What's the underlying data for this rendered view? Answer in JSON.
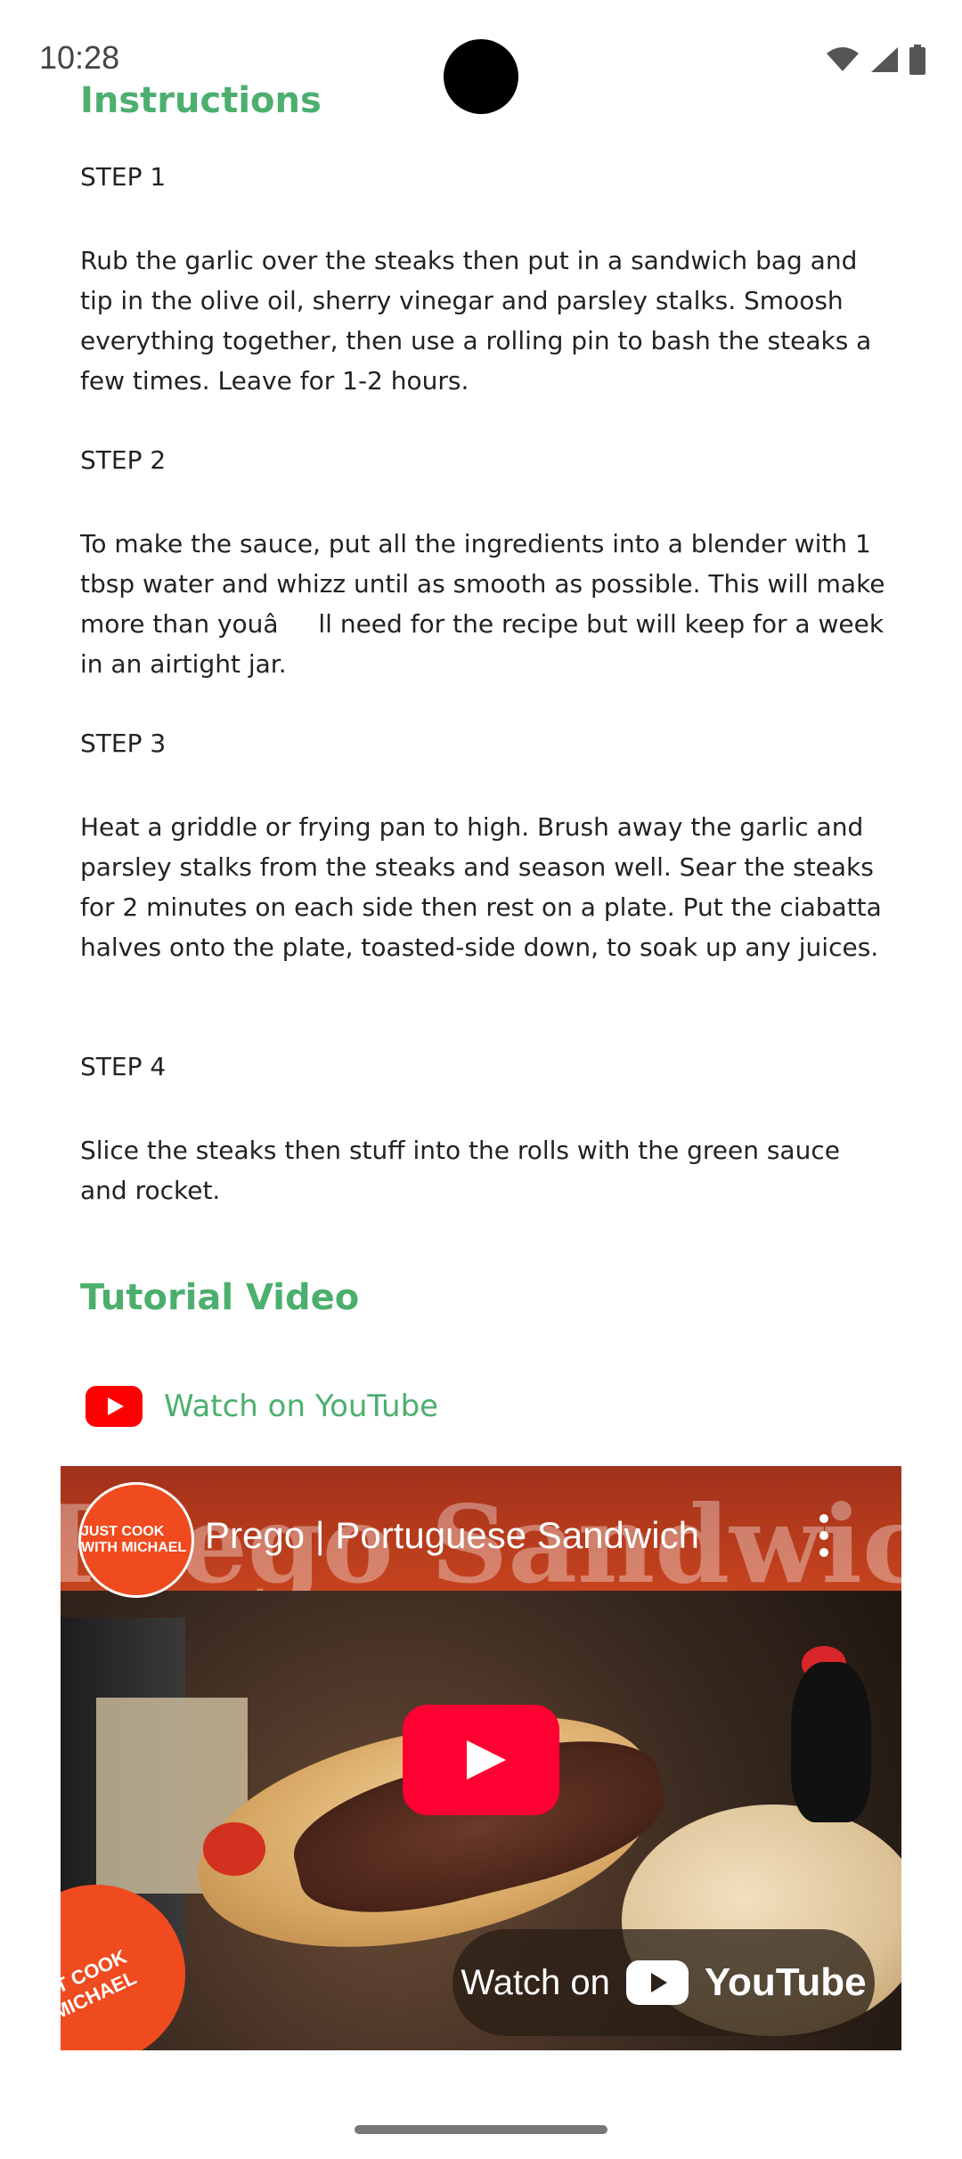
{
  "status_bar": {
    "time": "10:28"
  },
  "instructions": {
    "heading": "Instructions",
    "steps": [
      {
        "label": "STEP 1",
        "text": "Rub the garlic over the steaks then put in a sandwich bag and tip in the olive oil, sherry vinegar and parsley stalks. Smoosh everything together, then use a rolling pin to bash the steaks a few times. Leave for 1-2 hours."
      },
      {
        "label": "STEP 2",
        "text": "To make the sauce, put all the ingredients into a blender with 1 tbsp water and whizz until as smooth as possible. This will make more than youâll need for the recipe but will keep for a week in an airtight jar."
      },
      {
        "label": "STEP 3",
        "text": "Heat a griddle or frying pan to high. Brush away the garlic and parsley stalks from the steaks and season well. Sear the steaks for 2 minutes on each side then rest on a plate. Put the ciabatta halves onto the plate, toasted-side down, to soak up any juices."
      },
      {
        "label": "STEP 4",
        "text": "Slice the steaks then stuff into the rolls with the green sauce and rocket."
      }
    ]
  },
  "tutorial": {
    "heading": "Tutorial Video",
    "watch_link": "Watch on YouTube",
    "video": {
      "title": "Prego | Portuguese Sandwich",
      "watermark": "Prego Sandwich",
      "channel_badge": "JUST COOK WITH MICHAEL",
      "badge_text": "ST COOK MICHAEL",
      "watch_on": "Watch on",
      "brand": "YouTube"
    }
  },
  "colors": {
    "accent": "#4caf6e",
    "youtube_red": "#ff0000"
  }
}
